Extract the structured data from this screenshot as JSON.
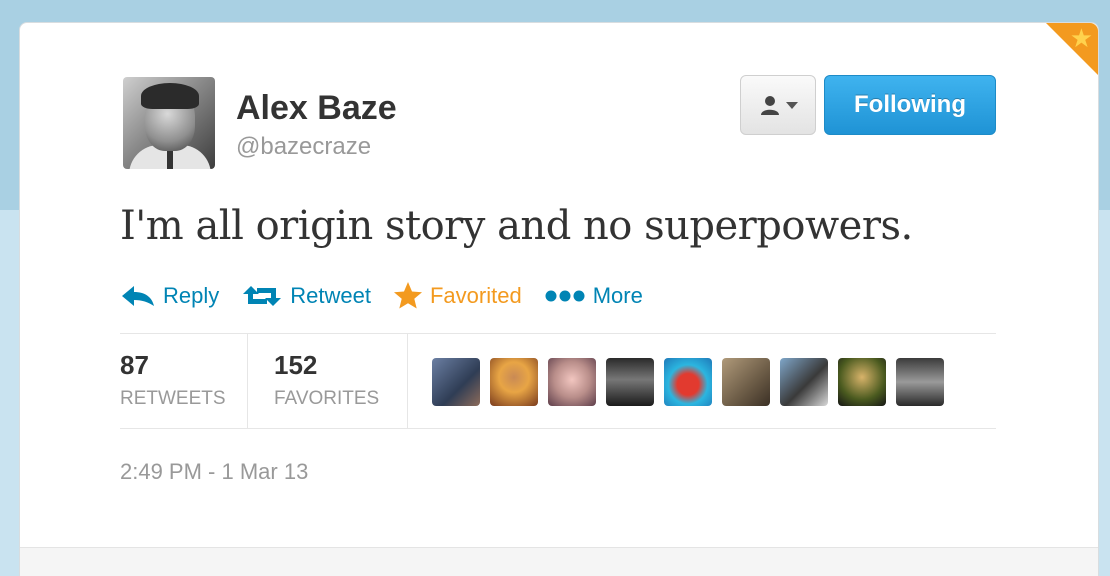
{
  "tweet": {
    "author": {
      "name": "Alex Baze",
      "handle": "@bazecraze"
    },
    "follow_button": {
      "label": "Following"
    },
    "text": "I'm all origin story and no superpowers.",
    "actions": [
      {
        "label": "Reply",
        "icon": "reply-icon"
      },
      {
        "label": "Retweet",
        "icon": "retweet-icon"
      },
      {
        "label": "Favorited",
        "icon": "star-icon"
      },
      {
        "label": "More",
        "icon": "more-dots-icon"
      }
    ],
    "stats": {
      "retweets": {
        "count": "87",
        "label": "RETWEETS"
      },
      "favorites": {
        "count": "152",
        "label": "FAVORITES"
      }
    },
    "favoriters_shown": 9,
    "timestamp": "2:49 PM - 1 Mar 13"
  },
  "colors": {
    "link": "#0084b4",
    "favorited": "#f39a1f",
    "follow_button": "#1f93d5",
    "page_background": "#a9d0e3"
  }
}
